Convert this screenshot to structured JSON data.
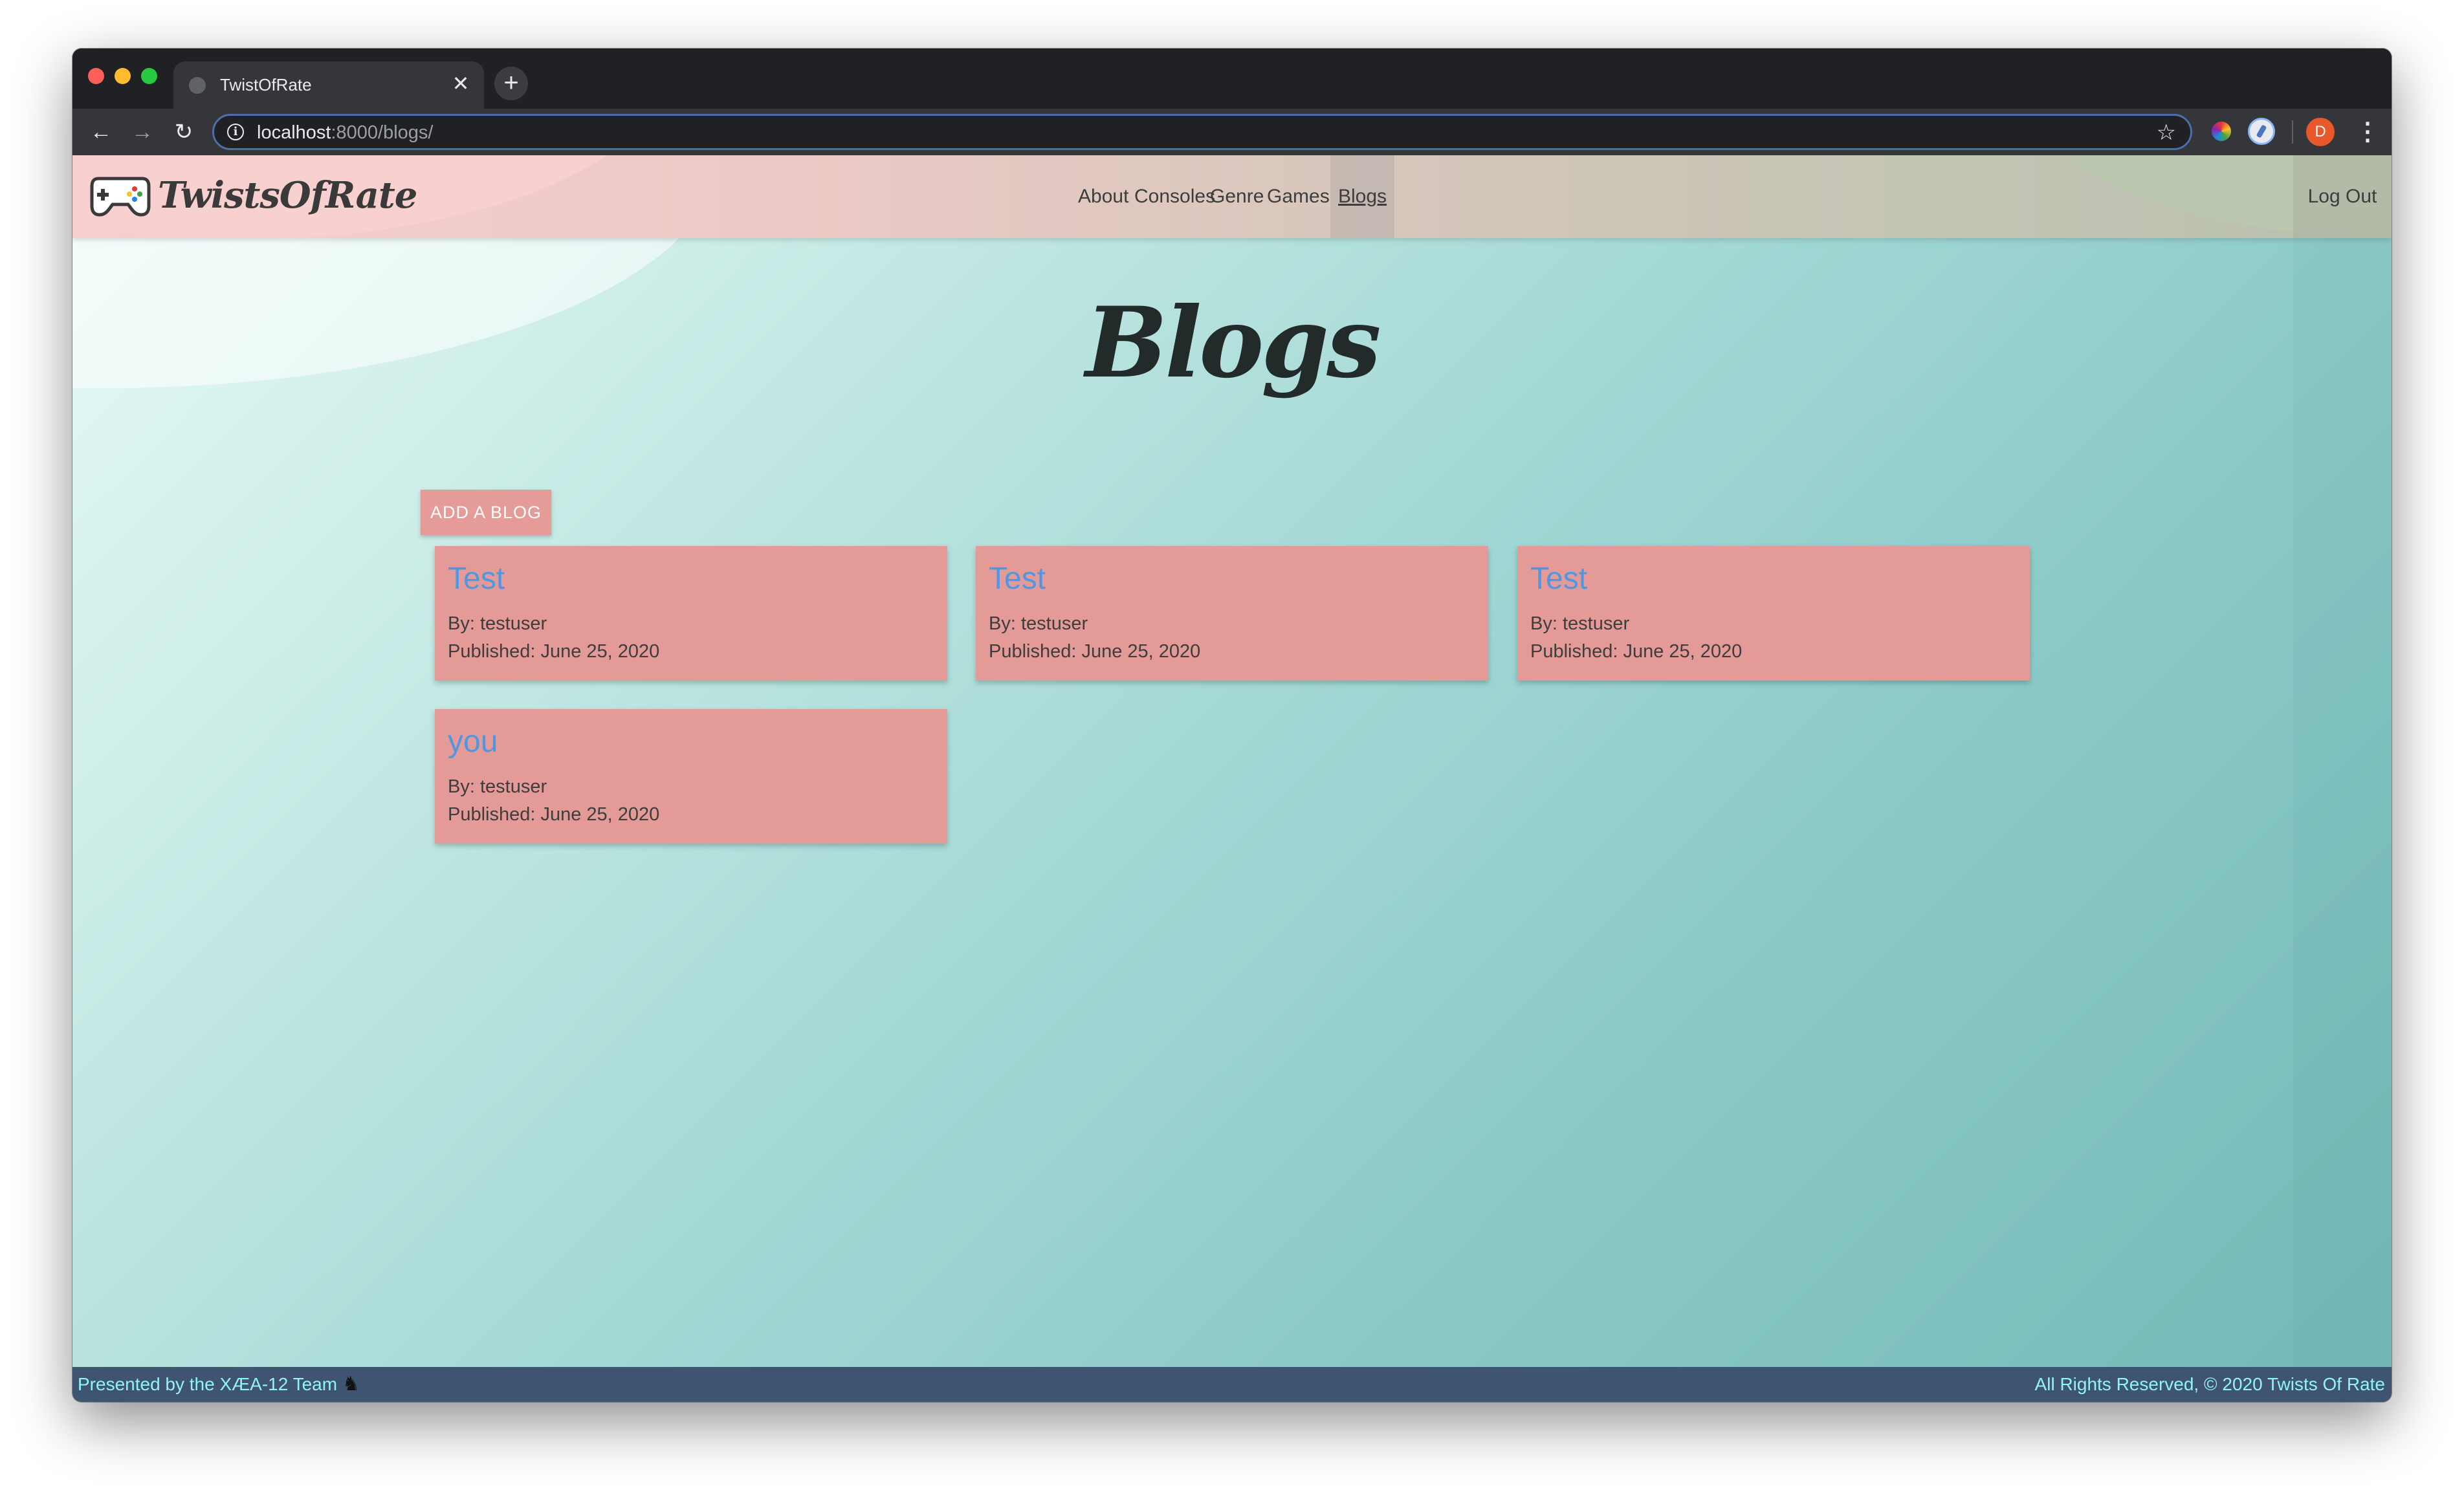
{
  "browser": {
    "tab_title": "TwistOfRate",
    "tab_close": "✕",
    "new_tab": "+",
    "url_host": "localhost",
    "url_path": ":8000/blogs/",
    "profile_initial": "D",
    "icons": {
      "back": "←",
      "forward": "→",
      "reload": "↻",
      "info": "i",
      "star": "☆",
      "menu": "⋮"
    }
  },
  "site": {
    "brand": "TwistsOfRate",
    "nav": [
      "About",
      "Consoles",
      "Genre",
      "Games",
      "Blogs"
    ],
    "active_nav": "Blogs",
    "logout": "Log Out"
  },
  "page": {
    "title": "Blogs",
    "add_button": "ADD A BLOG"
  },
  "blogs": [
    {
      "title": "Test",
      "author": "By: testuser",
      "published": "Published: June 25, 2020"
    },
    {
      "title": "Test",
      "author": "By: testuser",
      "published": "Published: June 25, 2020"
    },
    {
      "title": "Test",
      "author": "By: testuser",
      "published": "Published: June 25, 2020"
    },
    {
      "title": "you",
      "author": "By: testuser",
      "published": "Published: June 25, 2020"
    }
  ],
  "footer": {
    "left": "Presented by the XÆA-12 Team",
    "horse_icon": "♞",
    "right": "All Rights Reserved, © 2020 Twists Of Rate"
  },
  "colors": {
    "navbar_pink": "#f7cfcf",
    "card": "#e49b98",
    "card_title": "#4f96e3",
    "footer_bg": "#3e5470",
    "footer_text": "#8ff4f6"
  }
}
